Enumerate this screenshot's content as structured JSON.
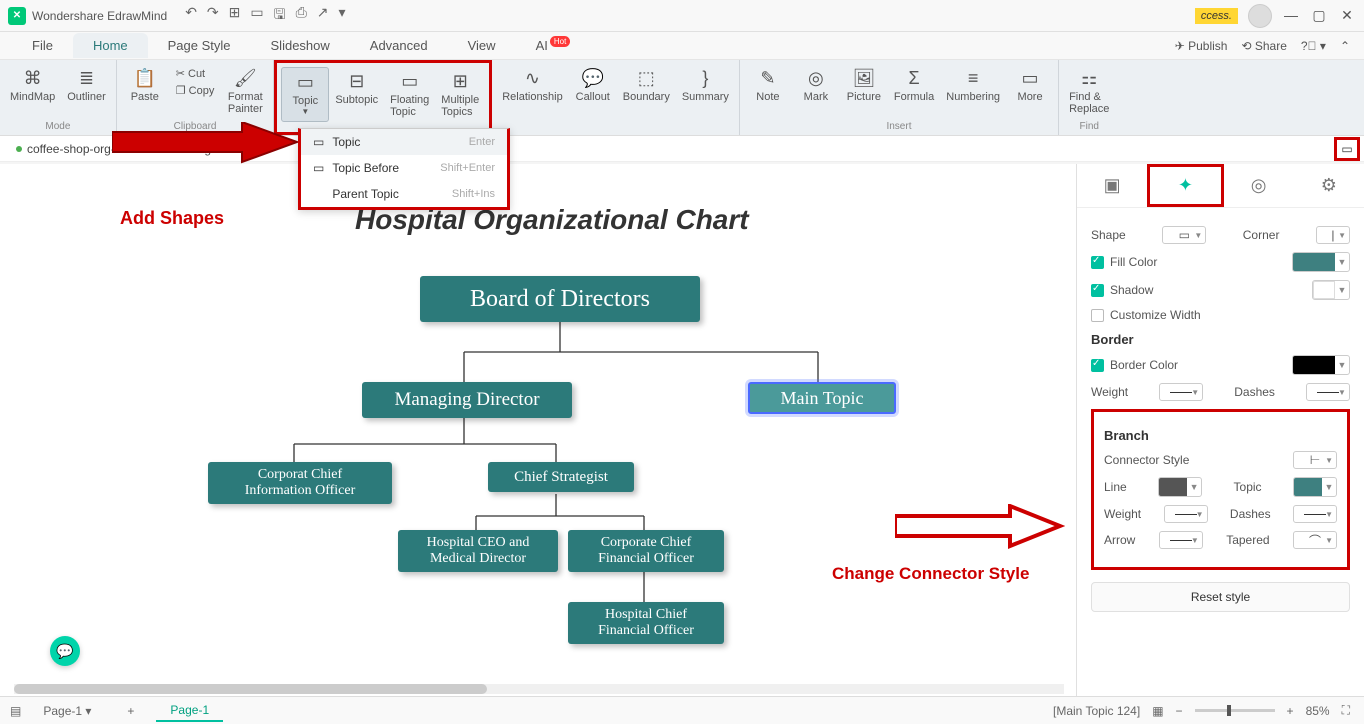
{
  "title": "Wondershare EdrawMind",
  "badge": "ccess.",
  "menu": {
    "file": "File",
    "home": "Home",
    "page_style": "Page Style",
    "slideshow": "Slideshow",
    "advanced": "Advanced",
    "view": "View",
    "ai": "AI",
    "hot": "Hot",
    "publish": "Publish",
    "share": "Share"
  },
  "ribbon": {
    "mindmap": "MindMap",
    "outliner": "Outliner",
    "mode": "Mode",
    "paste": "Paste",
    "cut": "Cut",
    "copy": "Copy",
    "format_painter": "Format\nPainter",
    "clipboard": "Clipboard",
    "topic": "Topic",
    "subtopic": "Subtopic",
    "floating": "Floating\nTopic",
    "multiple": "Multiple\nTopics",
    "relationship": "Relationship",
    "callout": "Callout",
    "boundary": "Boundary",
    "summary": "Summary",
    "note": "Note",
    "mark": "Mark",
    "picture": "Picture",
    "formula": "Formula",
    "numbering": "Numbering",
    "more": "More",
    "insert": "Insert",
    "find": "Find &\nReplace",
    "find_label": "Find"
  },
  "topic_menu": {
    "t1": "Topic",
    "s1": "Enter",
    "t2": "Topic Before",
    "s2": "Shift+Enter",
    "t3": "Parent Topic",
    "s3": "Shift+Ins"
  },
  "doc_tabs": {
    "t1": "coffee-shop-org-chart",
    "t2": "ics org chart"
  },
  "chart": {
    "title": "Hospital Organizational Chart",
    "n1": "Board of Directors",
    "n2": "Managing Director",
    "n3": "Main Topic",
    "n4": "Corporat Chief Information Officer",
    "n5": "Chief Strategist",
    "n6": "Hospital CEO and Medical Director",
    "n7": "Corporate Chief Financial Officer",
    "n8": "Hospital Chief Financial Officer"
  },
  "anno": {
    "add_shapes": "Add Shapes",
    "change_conn": "Change Connector Style"
  },
  "panel": {
    "shape": "Shape",
    "corner": "Corner",
    "fill": "Fill Color",
    "shadow": "Shadow",
    "custom_w": "Customize Width",
    "border": "Border",
    "border_color": "Border Color",
    "weight": "Weight",
    "dashes": "Dashes",
    "branch": "Branch",
    "connstyle": "Connector Style",
    "line": "Line",
    "topic": "Topic",
    "arrow": "Arrow",
    "tapered": "Tapered",
    "reset": "Reset style"
  },
  "status": {
    "page1": "Page-1",
    "page2": "Page-1",
    "plus": "+",
    "main_topic": "[Main Topic 124]",
    "zoom": "85%"
  }
}
